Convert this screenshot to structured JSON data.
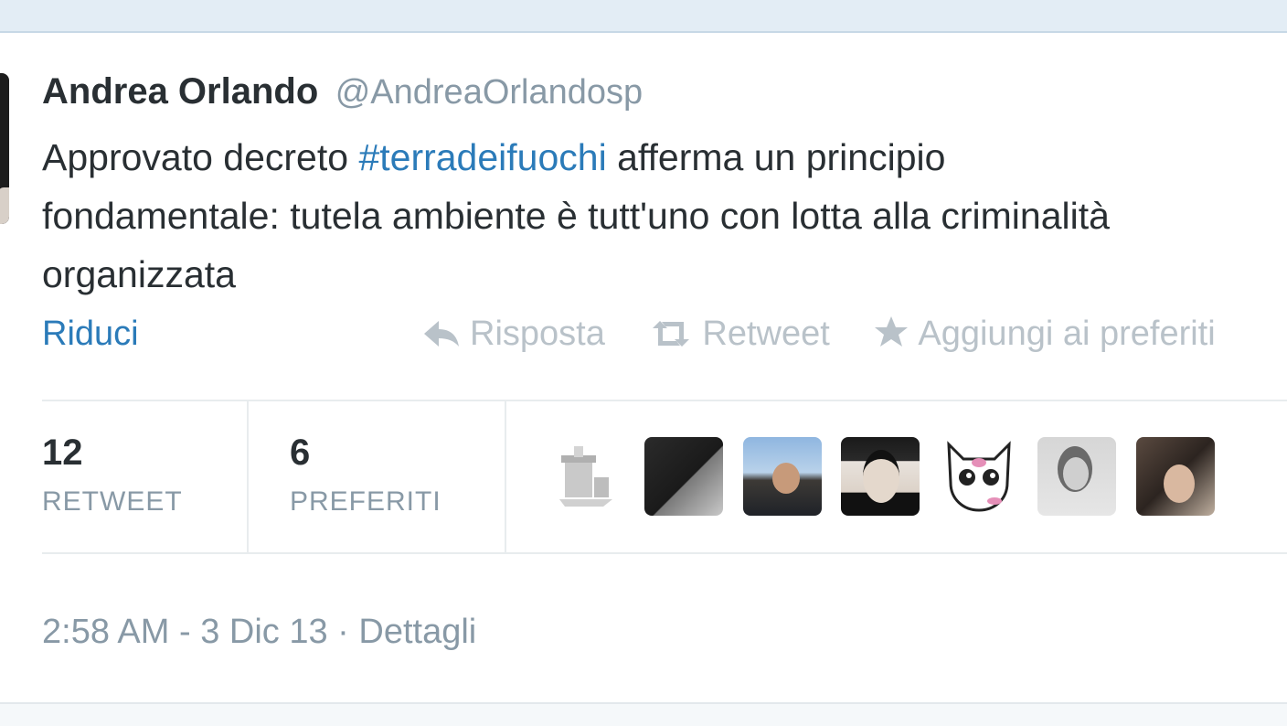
{
  "tweet": {
    "author_name": "Andrea Orlando",
    "author_handle": "@AndreaOrlandosp",
    "text_line1_before": "Approvato decreto ",
    "hashtag": "#terradeifuochi",
    "text_line1_after": " afferma un principio",
    "text_line2": "fondamentale: tutela ambiente è tutt'uno con lotta alla criminalità",
    "text_line3": "organizzata"
  },
  "actions": {
    "collapse_label": "Riduci",
    "reply_label": "Risposta",
    "retweet_label": "Retweet",
    "favorite_label": "Aggiungi ai preferiti",
    "reply_icon": "reply-arrow-icon",
    "retweet_icon": "retweet-icon",
    "favorite_icon": "star-icon"
  },
  "stats": {
    "retweets_count": "12",
    "retweets_label": "RETWEET",
    "favorites_count": "6",
    "favorites_label": "PREFERITI"
  },
  "facepile_count": 7,
  "meta": {
    "timestamp": "2:58 AM - 3 Dic 13",
    "separator": " · ",
    "details_label": "Dettagli"
  },
  "colors": {
    "link": "#2b7bb9",
    "text": "#292f33",
    "muted": "#8899a6",
    "action_muted": "#b9c2c9"
  }
}
